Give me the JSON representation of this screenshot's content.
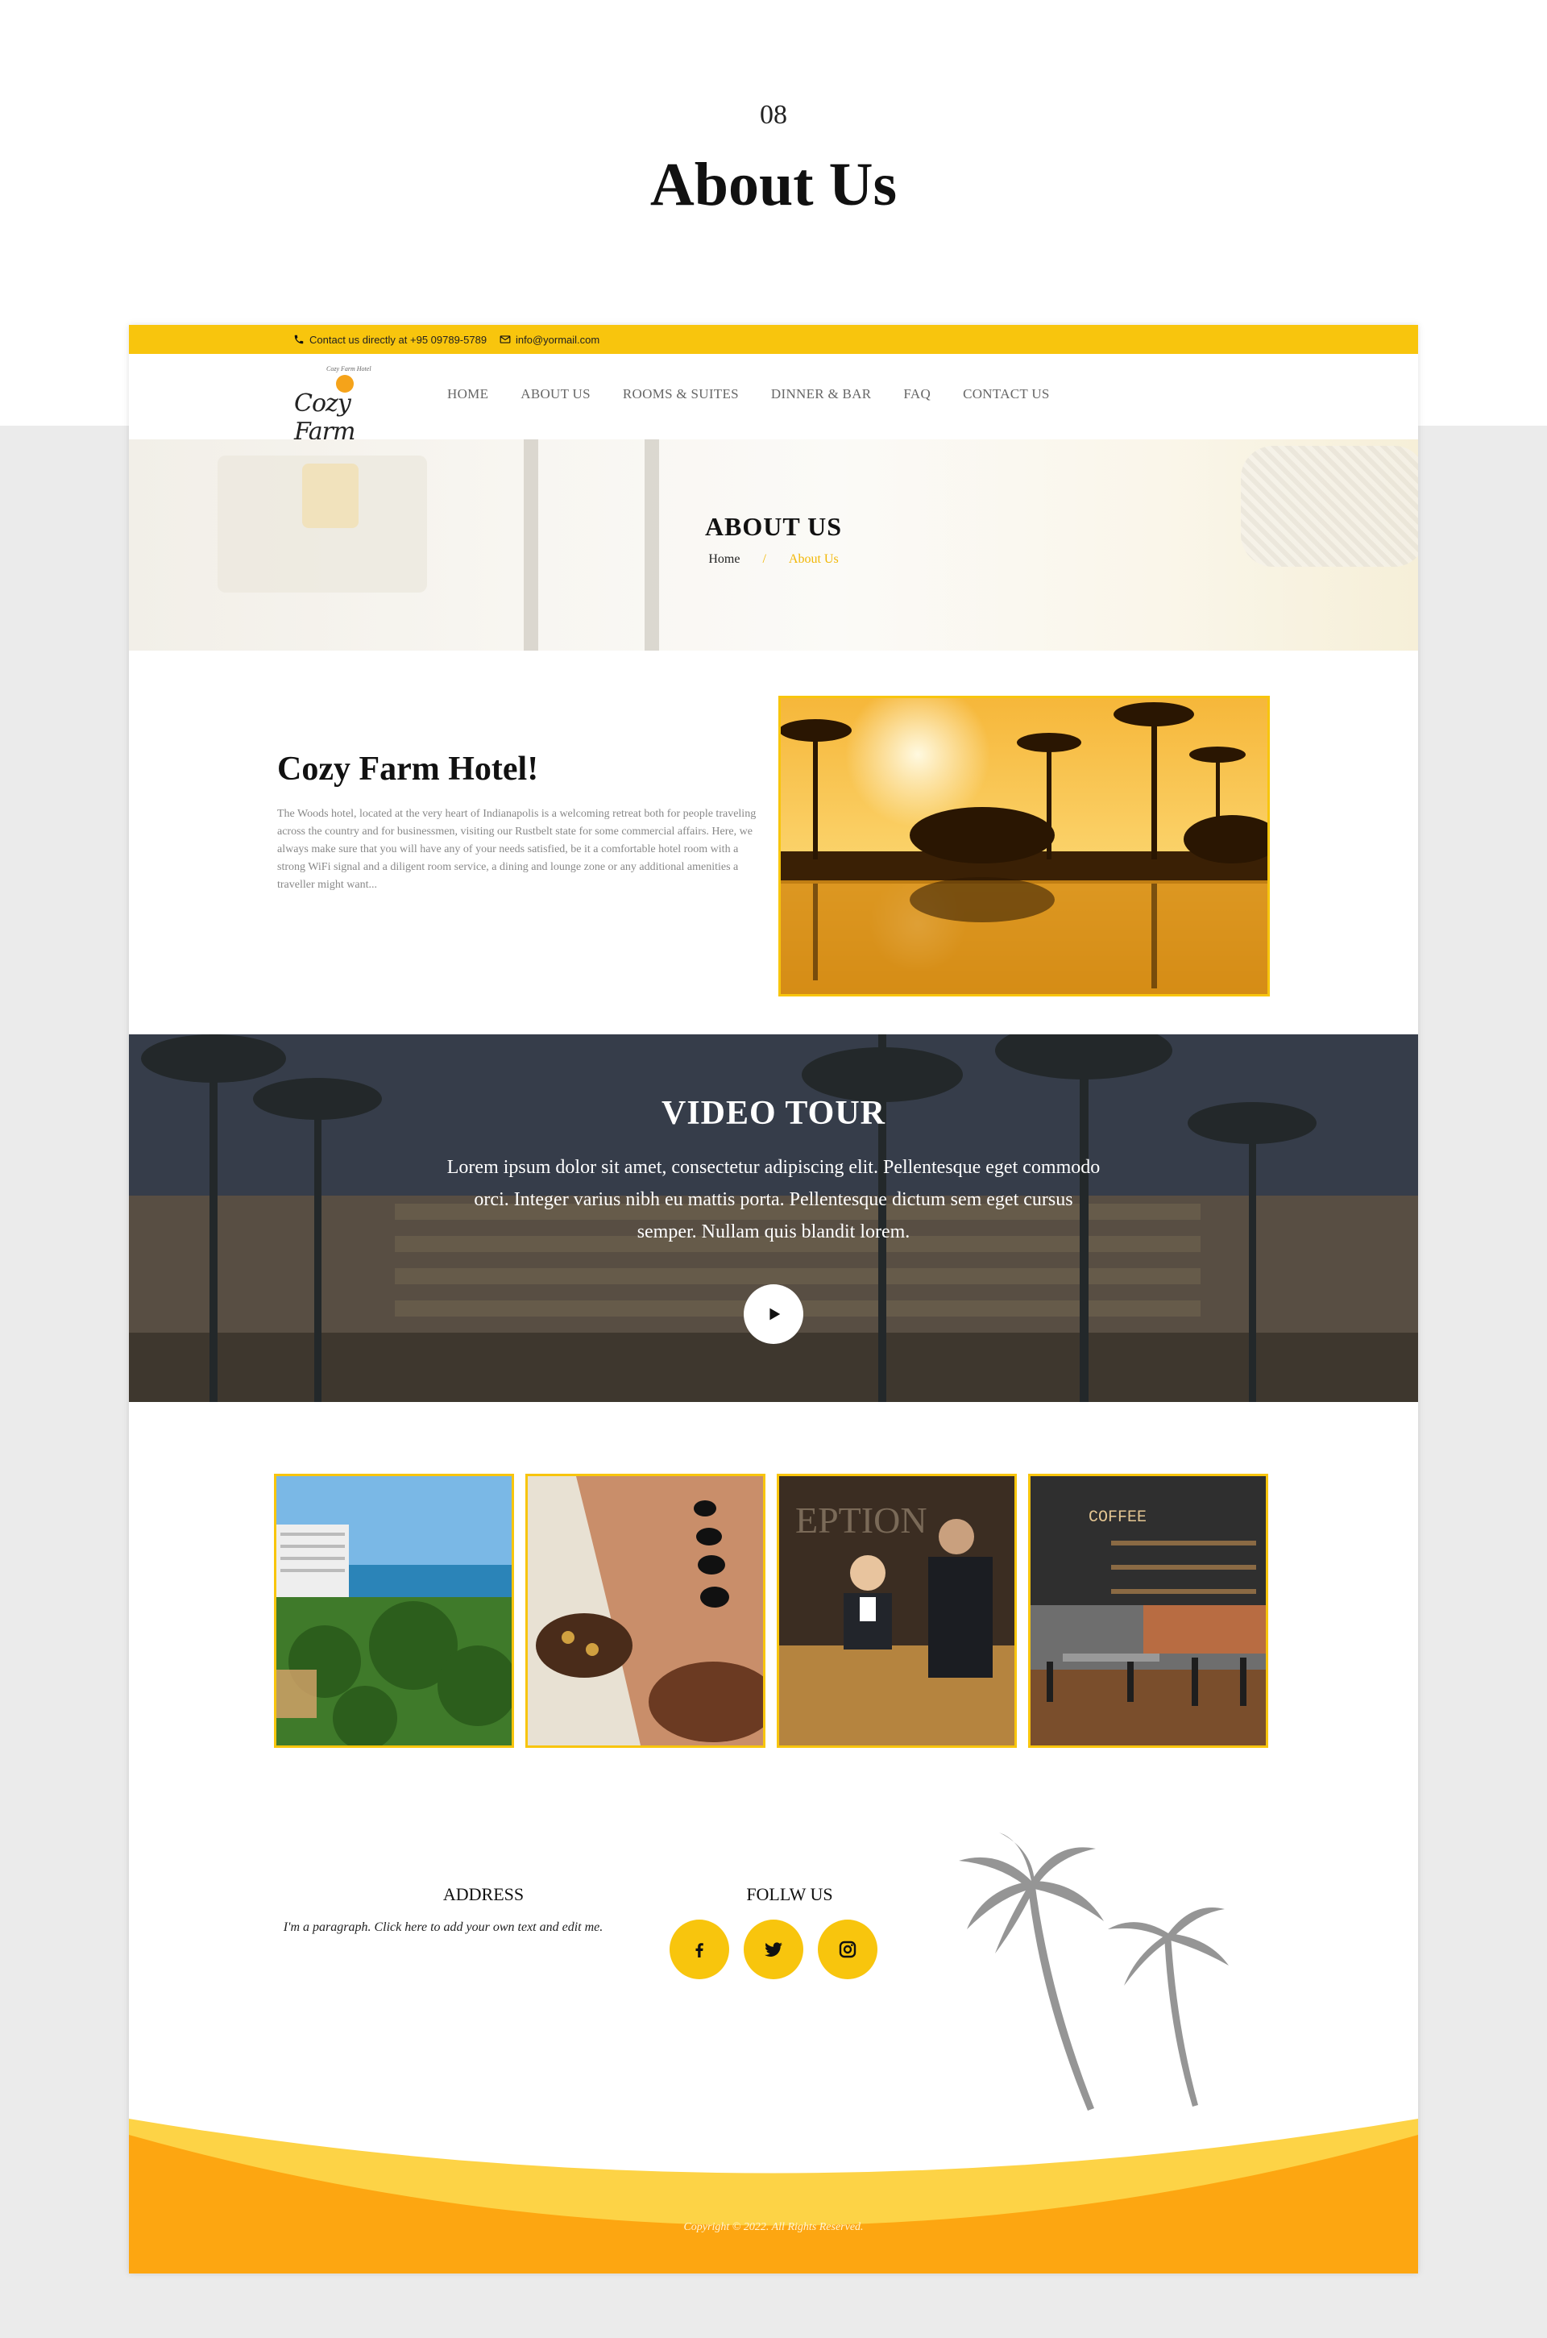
{
  "slide": {
    "number": "08",
    "title": "About Us"
  },
  "topbar": {
    "phone_text": "Contact us directly at +95 09789-5789",
    "email_text": "info@yormail.com"
  },
  "logo": {
    "name": "Cozy Farm",
    "tagline": "Cozy Farm Hotel"
  },
  "nav": {
    "items": [
      {
        "label": "HOME"
      },
      {
        "label": "ABOUT US"
      },
      {
        "label": "ROOMS & SUITES"
      },
      {
        "label": "DINNER & BAR"
      },
      {
        "label": "FAQ"
      },
      {
        "label": "CONTACT US"
      }
    ]
  },
  "hero": {
    "title": "ABOUT US",
    "breadcrumb": {
      "home": "Home",
      "separator": "/",
      "current": "About Us"
    }
  },
  "about": {
    "title": "Cozy Farm Hotel!",
    "text": "The Woods hotel, located at the very heart of Indianapolis is a welcoming retreat both for people traveling across the country and for businessmen, visiting our Rustbelt state for some commercial affairs. Here, we always make sure that you will have any of your needs satisfied, be it a comfortable hotel room with a strong WiFi signal and a diligent room service, a dining and lounge zone or any additional amenities a traveller might want..."
  },
  "video": {
    "title": "VIDEO TOUR",
    "text": "Lorem ipsum dolor sit amet, consectetur adipiscing elit. Pellentesque eget commodo orci. Integer varius nibh eu mattis porta. Pellentesque dictum sem eget cursus semper. Nullam quis blandit lorem."
  },
  "gallery": {
    "tiles": [
      {
        "subject": "beach resort"
      },
      {
        "subject": "hot stone spa"
      },
      {
        "subject": "reception desk",
        "sign_text": "EPTION"
      },
      {
        "subject": "coffee bar",
        "sign_text": "COFFEE"
      }
    ]
  },
  "footer": {
    "address_title": "ADDRESS",
    "address_text": "I'm a paragraph. Click here to add your own text and edit me.",
    "follow_title": "FOLLW US",
    "social": [
      {
        "icon": "facebook-icon"
      },
      {
        "icon": "twitter-icon"
      },
      {
        "icon": "instagram-icon"
      }
    ],
    "copyright": "Copyright © 2022. All Rights Reserved."
  },
  "colors": {
    "accent": "#f8c50d",
    "footer_orange": "#fda611",
    "footer_light": "#fdd346"
  }
}
